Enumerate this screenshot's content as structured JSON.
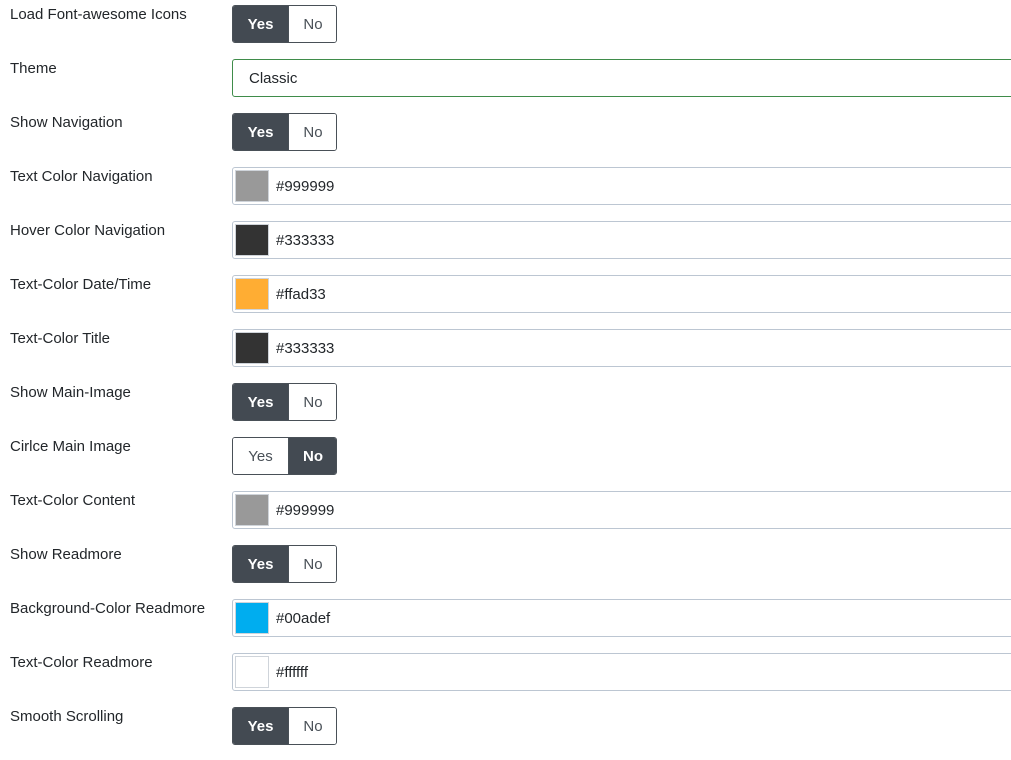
{
  "rows": [
    {
      "label": "Load Font-awesome Icons",
      "yes": "Yes",
      "no": "No",
      "selected": "yes"
    },
    {
      "label": "Theme",
      "value": "Classic"
    },
    {
      "label": "Show Navigation",
      "yes": "Yes",
      "no": "No",
      "selected": "yes"
    },
    {
      "label": "Text Color Navigation",
      "color": "#999999"
    },
    {
      "label": "Hover Color Navigation",
      "color": "#333333"
    },
    {
      "label": "Text-Color Date/Time",
      "color": "#ffad33"
    },
    {
      "label": "Text-Color Title",
      "color": "#333333"
    },
    {
      "label": "Show Main-Image",
      "yes": "Yes",
      "no": "No",
      "selected": "yes"
    },
    {
      "label": "Cirlce Main Image",
      "yes": "Yes",
      "no": "No",
      "selected": "no"
    },
    {
      "label": "Text-Color Content",
      "color": "#999999"
    },
    {
      "label": "Show Readmore",
      "yes": "Yes",
      "no": "No",
      "selected": "yes"
    },
    {
      "label": "Background-Color Readmore",
      "color": "#00adef"
    },
    {
      "label": "Text-Color Readmore",
      "color": "#ffffff"
    },
    {
      "label": "Smooth Scrolling",
      "yes": "Yes",
      "no": "No",
      "selected": "yes"
    }
  ]
}
